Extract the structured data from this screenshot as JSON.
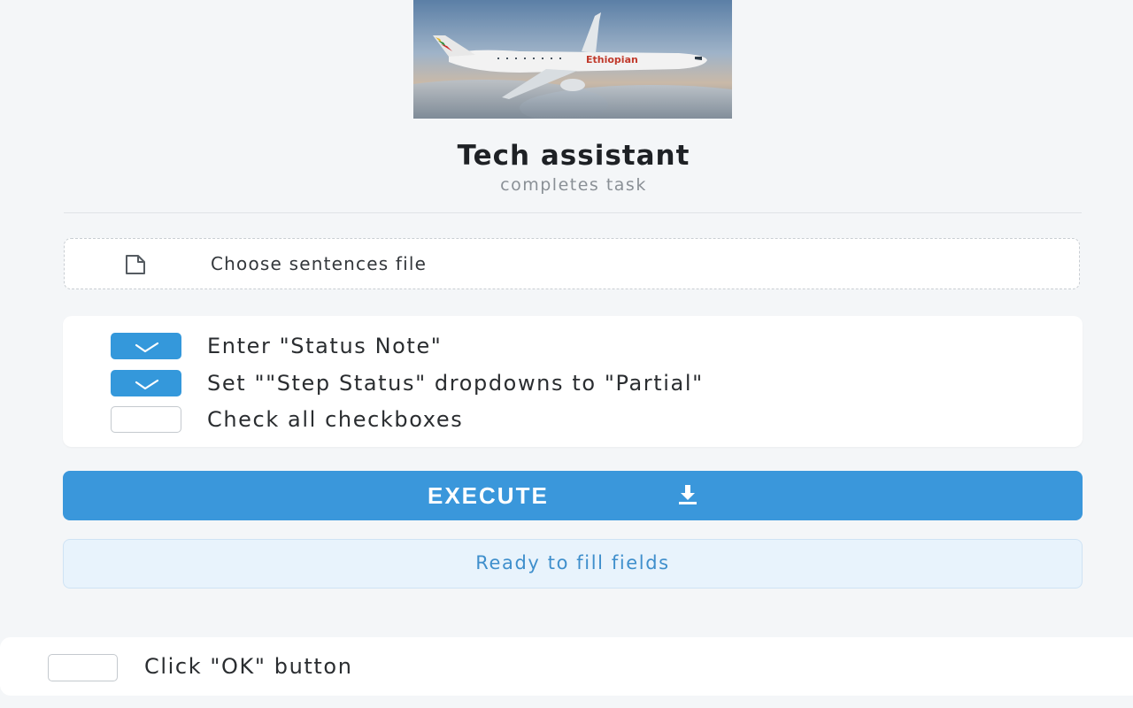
{
  "header": {
    "title": "Tech assistant",
    "subtitle": "completes task"
  },
  "hero_image": {
    "description_icon": "airplane-photo",
    "airline_text": "Ethiopian"
  },
  "file_chooser": {
    "label": "Choose sentences file",
    "icon": "file-icon"
  },
  "tasks": [
    {
      "label": "Enter \"Status Note\"",
      "checked": true
    },
    {
      "label": "Set \"\"Step Status\" dropdowns to \"Partial\"",
      "checked": true
    },
    {
      "label": "Check all checkboxes",
      "checked": false
    }
  ],
  "execute": {
    "label": "EXECUTE",
    "icon": "download-icon"
  },
  "status": {
    "text": "Ready to fill fields"
  },
  "bottom_step": {
    "label": "Click \"OK\" button",
    "checked": false
  },
  "colors": {
    "accent": "#3a97db",
    "status_bg": "#e8f3fc",
    "status_text": "#3f8fcc",
    "page_bg": "#f4f6f8"
  }
}
